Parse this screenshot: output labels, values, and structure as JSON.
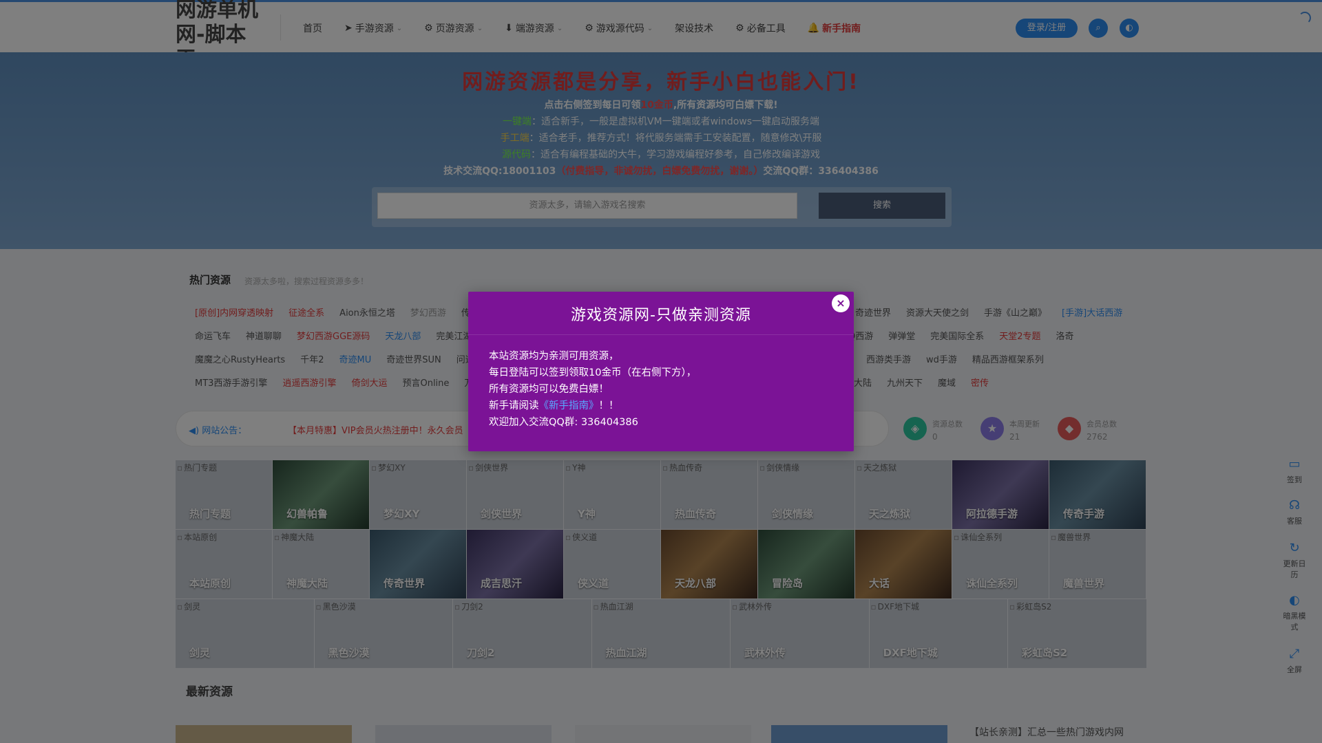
{
  "header": {
    "logo": "网游单机网-脚本王",
    "nav": [
      {
        "label": "首页",
        "icon": "",
        "caret": false
      },
      {
        "label": "手游资源",
        "icon": "➤",
        "caret": true
      },
      {
        "label": "页游资源",
        "icon": "⚙",
        "caret": true
      },
      {
        "label": "端游资源",
        "icon": "⬇",
        "caret": true
      },
      {
        "label": "游戏源代码",
        "icon": "⚙",
        "caret": true
      },
      {
        "label": "架设技术",
        "icon": "",
        "caret": false
      },
      {
        "label": "必备工具",
        "icon": "⚙",
        "caret": false
      },
      {
        "label": "新手指南",
        "icon": "🔔",
        "caret": false
      }
    ],
    "login_label": "登录/注册",
    "search_icon": "search-icon",
    "theme_icon": "theme-icon"
  },
  "hero": {
    "title": "网游资源都是分享，新手小白也能入门!",
    "line1_pre": "点击右侧签到每日可领",
    "line1_hl": "10金币",
    "line1_post": ",所有资源均可白嫖下载!",
    "line2_hl": "一键端",
    "line2_text": "：适合新手，一般是虚拟机VM一键端或者windows一键启动服务端",
    "line3_hl": "手工端",
    "line3_text": "：适合老手，推荐方式！将代服务端需手工安装配置，随意修改\\开服",
    "line4_hl": "源代码",
    "line4_text": "：适合有编程基础的大牛，学习游戏编程好参考，自己修改编译游戏",
    "line5_pre": "技术交流QQ:18001103",
    "line5_hl": "（付费指导，非诚勿扰，白嫖免费勿扰，谢谢。）",
    "line5_post": "交流QQ群：336404386",
    "search_placeholder": "资源太多，请输入游戏名搜索",
    "search_button": "搜索"
  },
  "hot": {
    "title": "热门资源",
    "subtitle": "资源太多啦，搜索过程资源多多！",
    "row1": [
      "[原创]内网穿透映射",
      "征途全系",
      "Aion永恒之塔",
      "梦幻西游",
      "传"
    ],
    "row1_right": [
      "奇迹世界",
      "资源大天使之剑",
      "手游《山之巅》",
      "[手游]大话西游"
    ],
    "row2": [
      "命运飞车",
      "神道聊聊",
      "梦幻西游GGE源码",
      "天龙八部",
      "完美江湖"
    ],
    "row2_right": [
      "Q西游",
      "弹弹堂",
      "完美国际全系",
      "天堂2专题",
      "洛奇"
    ],
    "row3": [
      "魔魔之心RustyHearts",
      "千年2",
      "奇迹MU",
      "奇迹世界SUN",
      "问道"
    ],
    "row3_right": [
      "西游类手游",
      "wd手游",
      "精品西游框架系列"
    ],
    "row4": [
      "MT3西游手游引擎",
      "逍遥西游引擎",
      "倚剑大运",
      "预言Online",
      "万王之王"
    ],
    "row4_right": [
      "大陆",
      "九州天下",
      "魔域",
      "密传"
    ]
  },
  "notice": {
    "label": "网站公告：",
    "text": "【本月特惠】VIP会员火热注册中！永久会员"
  },
  "stats": [
    {
      "label": "资源总数",
      "value": "0",
      "icon": "layers-icon",
      "color": "#2dc8a0"
    },
    {
      "label": "本周更新",
      "value": "21",
      "icon": "star-icon",
      "color": "#8c7ce8"
    },
    {
      "label": "会员总数",
      "value": "2762",
      "icon": "stack-icon",
      "color": "#e65a5a"
    }
  ],
  "tiles_row1": [
    {
      "alt": "热门专题",
      "label": "热门专题",
      "img": false
    },
    {
      "alt": "",
      "label": "幻兽帕鲁",
      "img": true,
      "tone": "green"
    },
    {
      "alt": "梦幻XY",
      "label": "梦幻XY",
      "img": false
    },
    {
      "alt": "剑侠世界",
      "label": "剑侠世界",
      "img": false
    },
    {
      "alt": "Y神",
      "label": "Y神",
      "img": false
    },
    {
      "alt": "热血传奇",
      "label": "热血传奇",
      "img": false
    },
    {
      "alt": "剑侠情缘",
      "label": "剑侠情缘",
      "img": false
    },
    {
      "alt": "天之炼狱",
      "label": "天之炼狱",
      "img": false
    },
    {
      "alt": "",
      "label": "阿拉德手游",
      "img": true,
      "tone": "purple"
    },
    {
      "alt": "",
      "label": "传奇手游",
      "img": true,
      "tone": ""
    }
  ],
  "tiles_row2": [
    {
      "alt": "本站原创",
      "label": "本站原创",
      "img": false
    },
    {
      "alt": "神魔大陆",
      "label": "神魔大陆",
      "img": false
    },
    {
      "alt": "",
      "label": "传奇世界",
      "img": true,
      "tone": ""
    },
    {
      "alt": "",
      "label": "成吉思汗",
      "img": true,
      "tone": "purple"
    },
    {
      "alt": "侠义道",
      "label": "侠义道",
      "img": false
    },
    {
      "alt": "",
      "label": "天龙八部",
      "img": true,
      "tone": "warm"
    },
    {
      "alt": "",
      "label": "冒险岛",
      "img": true,
      "tone": "green"
    },
    {
      "alt": "",
      "label": "大话",
      "img": true,
      "tone": "warm"
    },
    {
      "alt": "诛仙全系列",
      "label": "诛仙全系列",
      "img": false
    },
    {
      "alt": "魔兽世界",
      "label": "魔兽世界",
      "img": false
    }
  ],
  "tiles_row3": [
    {
      "alt": "剑灵",
      "label": "剑灵"
    },
    {
      "alt": "黑色沙漠",
      "label": "黑色沙漠"
    },
    {
      "alt": "刀剑2",
      "label": "刀剑2"
    },
    {
      "alt": "热血江湖",
      "label": "热血江湖"
    },
    {
      "alt": "武林外传",
      "label": "武林外传"
    },
    {
      "alt": "DXF地下城",
      "label": "DXF地下城"
    },
    {
      "alt": "彩虹岛S2",
      "label": "彩虹岛S2"
    }
  ],
  "latest": {
    "title": "最新资源",
    "side_text": "【站长亲测】汇总一些热门游戏内网"
  },
  "float_bar": [
    {
      "label": "签到",
      "icon": "calendar-icon"
    },
    {
      "label": "客服",
      "icon": "headset-icon"
    },
    {
      "label": "更新日历",
      "icon": "refresh-icon"
    },
    {
      "label": "暗黑模式",
      "icon": "moon-icon"
    },
    {
      "label": "全屏",
      "icon": "fullscreen-icon"
    }
  ],
  "modal": {
    "title": "游戏资源网-只做亲测资源",
    "line1": "本站资源均为亲测可用资源，",
    "line2": "每日登陆可以签到领取10金币（在右侧下方），",
    "line3": "所有资源均可以免费白嫖！",
    "line4_pre": "新手请阅读",
    "line4_link": "《新手指南》",
    "line4_post": "！！",
    "line5": "欢迎加入交流QQ群: 336404386",
    "close": "×"
  },
  "colors": {
    "primary": "#2d8cf0",
    "modal_bg": "#7b1396",
    "accent_red": "#e33b3b"
  }
}
